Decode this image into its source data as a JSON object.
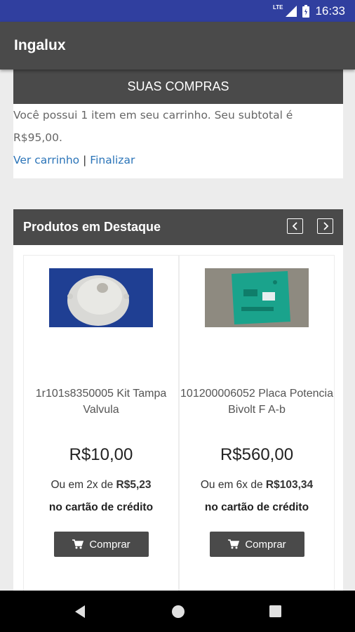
{
  "status_bar": {
    "network": "LTE",
    "time": "16:33"
  },
  "app": {
    "title": "Ingalux"
  },
  "cart": {
    "header": "SUAS COMPRAS",
    "summary": "Você possui 1 item em seu carrinho. Seu subtotal é R$95,00.",
    "view_cart_link": "Ver carrinho",
    "separator": "|",
    "checkout_link": "Finalizar"
  },
  "featured": {
    "title": "Produtos em Destaque",
    "prev_icon": "chevron-left-icon",
    "next_icon": "chevron-right-icon",
    "products": [
      {
        "name": "1r101s8350005 Kit Tampa Valvula",
        "price": "R$10,00",
        "installments_prefix": "Ou em 2x de ",
        "installment_value": "R$5,23",
        "card_text": "no cartão de crédito",
        "buy_label": "Comprar"
      },
      {
        "name": "101200006052 Placa Potencia Bivolt F A-b",
        "price": "R$560,00",
        "installments_prefix": "Ou em 6x de ",
        "installment_value": "R$103,34",
        "card_text": "no cartão de crédito",
        "buy_label": "Comprar"
      }
    ]
  },
  "colors": {
    "status_bar": "#303f9f",
    "header_dark": "#4a4a4a",
    "link": "#2b74b8"
  }
}
